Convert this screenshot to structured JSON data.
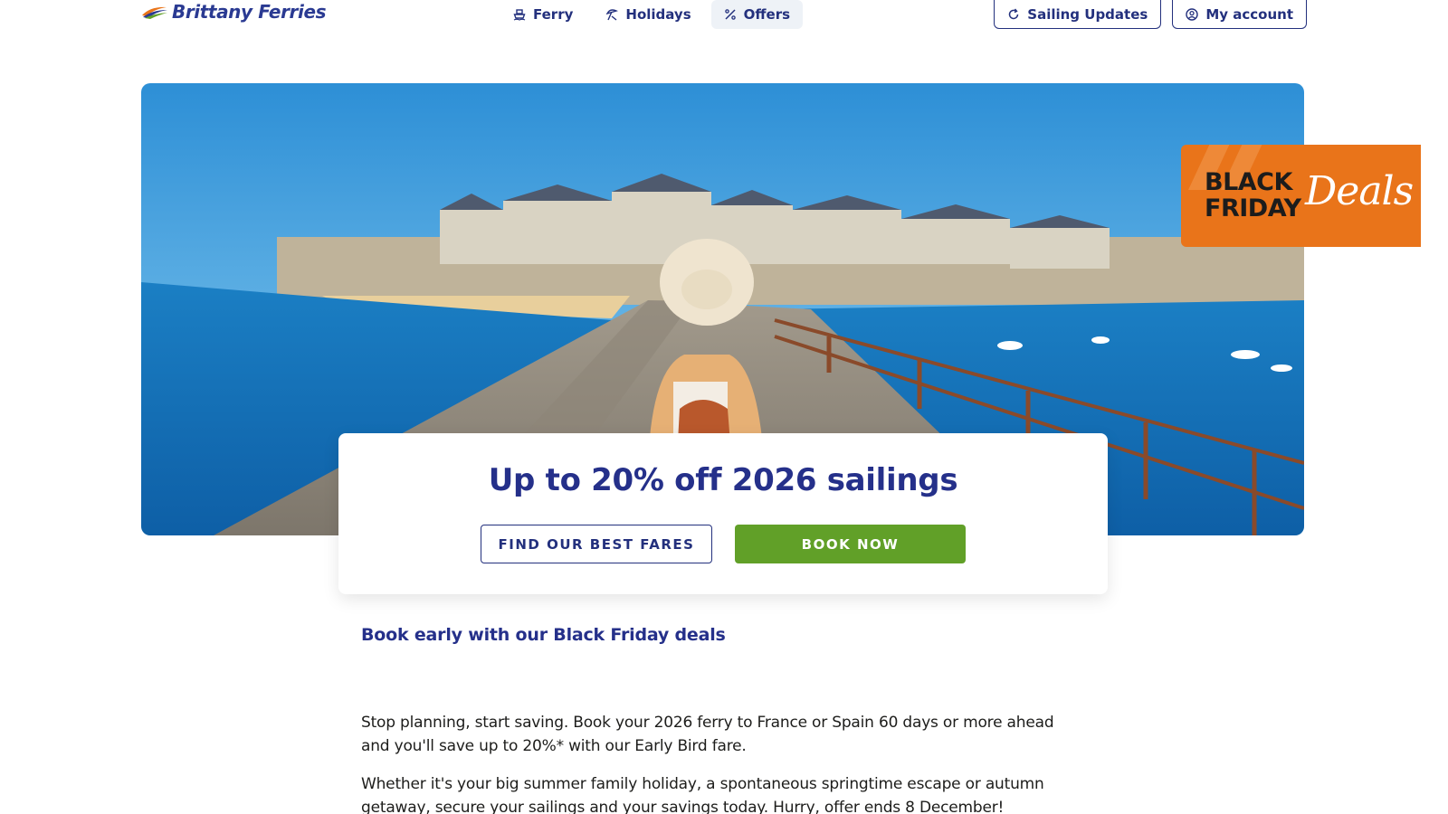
{
  "header": {
    "logo_text": "Brittany Ferries",
    "nav": [
      {
        "label": "Ferry",
        "icon": "ship-icon"
      },
      {
        "label": "Holidays",
        "icon": "beach-umbrella-icon"
      },
      {
        "label": "Offers",
        "icon": "percent-icon",
        "active": true
      }
    ],
    "actions": [
      {
        "label": "Sailing Updates",
        "icon": "refresh-icon"
      },
      {
        "label": "My account",
        "icon": "user-circle-icon"
      }
    ]
  },
  "badge": {
    "line1": "BLACK",
    "line2": "FRIDAY",
    "script": "Deals",
    "color": "#e9741a"
  },
  "offer": {
    "title": "Up to 20% off 2026 sailings",
    "secondary_button": "FIND OUR BEST FARES",
    "primary_button": "BOOK NOW"
  },
  "content": {
    "subheading": "Book early with our Black Friday deals",
    "paragraph1": "Stop planning, start saving. Book your 2026 ferry to France or Spain 60 days or more ahead and you'll save up to 20%* with our Early Bird fare.",
    "paragraph2": "Whether it's your big summer family holiday, a spontaneous springtime escape or autumn getaway, secure your sailings and your savings today. Hurry, offer ends 8 December!"
  },
  "colors": {
    "brand_navy": "#25308a",
    "book_green": "#61a028",
    "badge_orange": "#e9741a"
  }
}
